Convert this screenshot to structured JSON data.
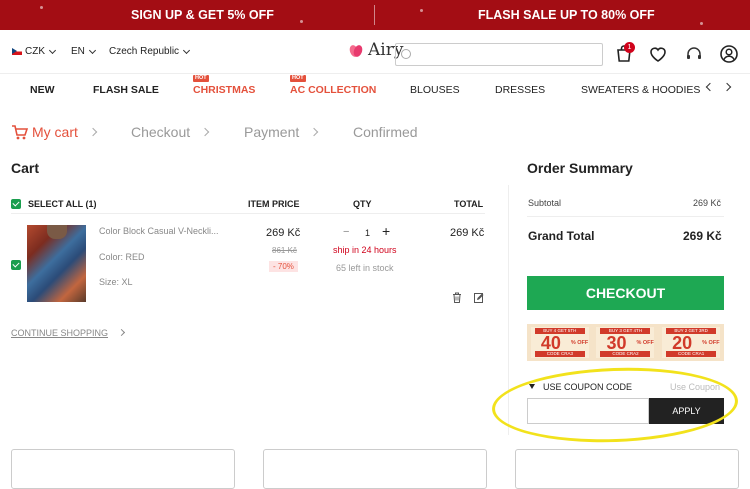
{
  "promo": {
    "left": "SIGN UP & GET 5% OFF",
    "right": "FLASH SALE UP TO 80% OFF",
    "background": "#a30d14"
  },
  "header": {
    "currency": "CZK",
    "language": "EN",
    "country": "Czech Republic",
    "logo_text": "Airy",
    "cart_count": "1",
    "icons": [
      "cart-icon",
      "heart-icon",
      "headset-icon",
      "user-icon"
    ]
  },
  "nav": {
    "items": [
      {
        "label": "NEW"
      },
      {
        "label": "FLASH SALE"
      },
      {
        "label": "CHRISTMAS",
        "badge": "HOT"
      },
      {
        "label": "AC COLLECTION",
        "badge": "HOT"
      },
      {
        "label": "BLOUSES"
      },
      {
        "label": "DRESSES"
      },
      {
        "label": "SWEATERS & HOODIES"
      }
    ]
  },
  "steps": [
    "My cart",
    "Checkout",
    "Payment",
    "Confirmed"
  ],
  "cart": {
    "title": "Cart",
    "select_all": "SELECT ALL (1)",
    "columns": [
      "ITEM PRICE",
      "QTY",
      "TOTAL"
    ],
    "item": {
      "name": "Color Block Casual V-Neckli...",
      "color": "Color: RED",
      "size": "Size: XL",
      "price": "269 Kč",
      "original_price": "861 Kč",
      "discount": "- 70%",
      "qty": "1",
      "minus": "−",
      "plus": "+",
      "shipping": "ship in 24 hours",
      "stock": "65 left in stock",
      "total": "269 Kč"
    },
    "continue": "CONTINUE SHOPPING"
  },
  "summary": {
    "title": "Order Summary",
    "subtotal_label": "Subtotal",
    "subtotal": "269 Kč",
    "grand_label": "Grand Total",
    "grand": "269 Kč",
    "checkout": "CHECKOUT",
    "coupons": [
      {
        "top": "BUY 4 GET 5TH",
        "value": "40",
        "off": "% OFF",
        "code": "CODE CRA3"
      },
      {
        "top": "BUY 3 GET 4TH",
        "value": "30",
        "off": "% OFF",
        "code": "CODE CRA2"
      },
      {
        "top": "BUY 2 GET 3RD",
        "value": "20",
        "off": "% OFF",
        "code": "CODE CRA1"
      }
    ],
    "use_coupon_label": "USE COUPON CODE",
    "use_coupon_link": "Use Coupon",
    "coupon_value": "",
    "apply": "APPLY",
    "accent": "#1ea853",
    "highlight": "#f2e21c"
  }
}
